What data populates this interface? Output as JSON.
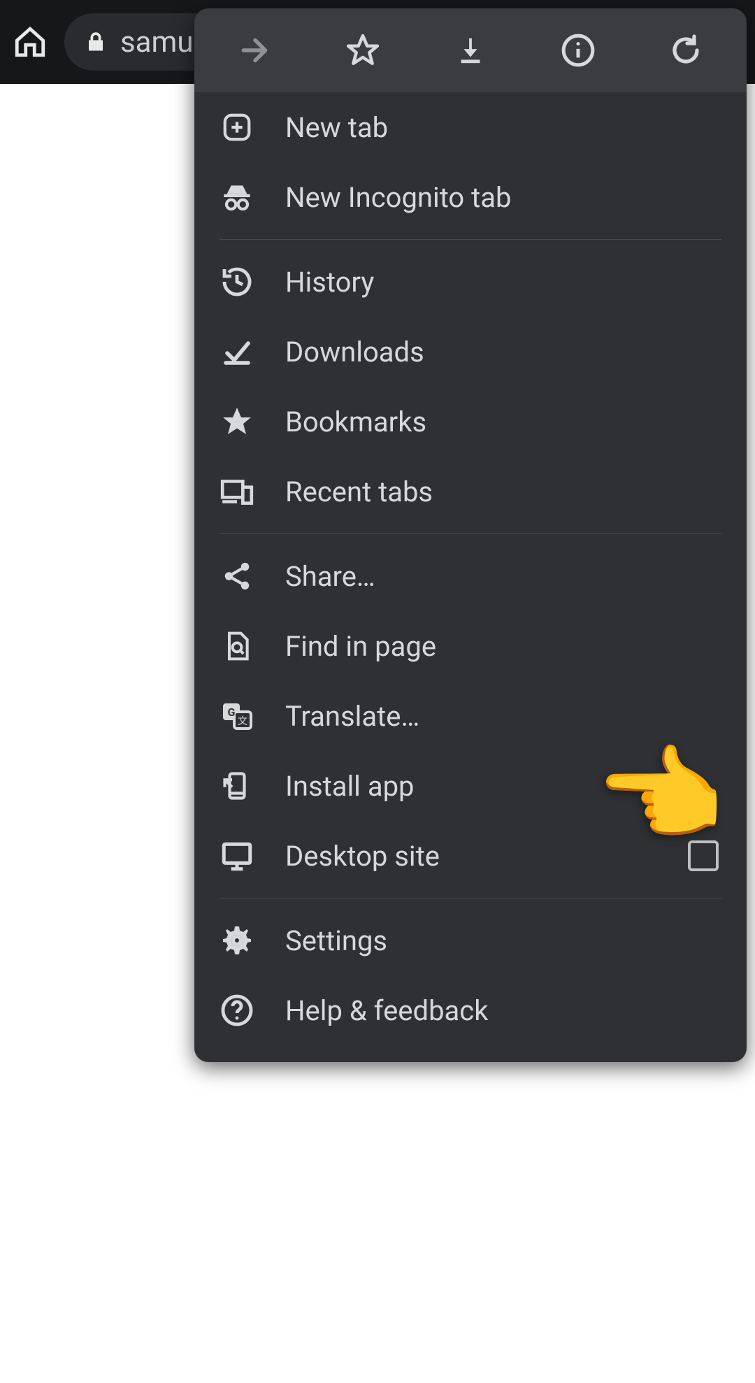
{
  "toolbar": {
    "url_text": "samulis"
  },
  "menu": {
    "items": [
      {
        "label": "New tab"
      },
      {
        "label": "New Incognito tab"
      },
      {
        "label": "History"
      },
      {
        "label": "Downloads"
      },
      {
        "label": "Bookmarks"
      },
      {
        "label": "Recent tabs"
      },
      {
        "label": "Share…"
      },
      {
        "label": "Find in page"
      },
      {
        "label": "Translate…"
      },
      {
        "label": "Install app"
      },
      {
        "label": "Desktop site"
      },
      {
        "label": "Settings"
      },
      {
        "label": "Help & feedback"
      }
    ]
  },
  "pointer_emoji": "👉"
}
